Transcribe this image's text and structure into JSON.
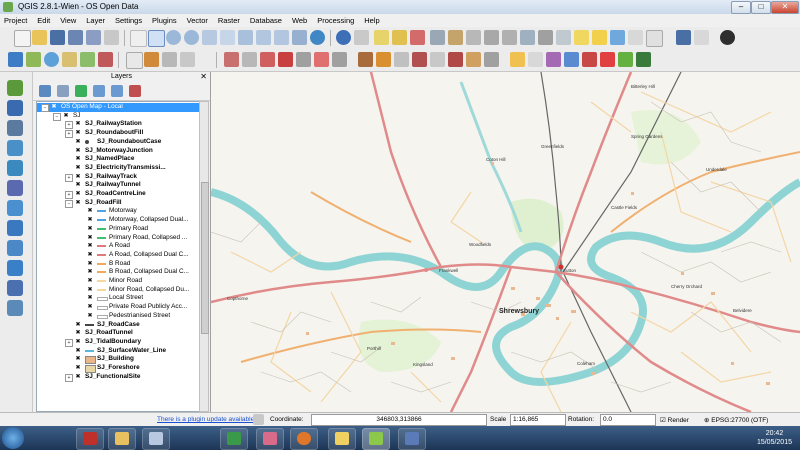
{
  "window": {
    "title": "QGIS 2.8.1-Wien - OS Open Data",
    "minimize": "–",
    "maximize": "□",
    "close": "✕"
  },
  "menu": [
    "Project",
    "Edit",
    "View",
    "Layer",
    "Settings",
    "Plugins",
    "Vector",
    "Raster",
    "Database",
    "Web",
    "Processing",
    "Help"
  ],
  "layers_panel": {
    "title": "Layers",
    "close": "✕",
    "items": [
      {
        "label": "OS Open Map - Local",
        "level": 0,
        "selected": true,
        "expander": "−"
      },
      {
        "label": "SJ",
        "level": 1,
        "expander": "−"
      },
      {
        "label": "SJ_RailwayStation",
        "level": 2,
        "expander": "+",
        "bold": true
      },
      {
        "label": "SJ_RoundaboutFill",
        "level": 2,
        "expander": "+",
        "bold": true
      },
      {
        "label": "SJ_RoundaboutCase",
        "level": 2,
        "bold": true,
        "symbol": "dot"
      },
      {
        "label": "SJ_MotorwayJunction",
        "level": 2,
        "bold": true
      },
      {
        "label": "SJ_NamedPlace",
        "level": 2,
        "bold": true
      },
      {
        "label": "SJ_ElectricityTransmissi...",
        "level": 2,
        "bold": true
      },
      {
        "label": "SJ_RailwayTrack",
        "level": 2,
        "expander": "+",
        "bold": true
      },
      {
        "label": "SJ_RailwayTunnel",
        "level": 2,
        "bold": true
      },
      {
        "label": "SJ_RoadCentreLine",
        "level": 2,
        "expander": "+",
        "bold": true
      },
      {
        "label": "SJ_RoadFill",
        "level": 2,
        "expander": "−",
        "bold": true
      },
      {
        "label": "Motorway",
        "level": 3,
        "symbol": "line",
        "color": "#4fa3e0"
      },
      {
        "label": "Motorway, Collapsed Dual...",
        "level": 3,
        "symbol": "line",
        "color": "#4fa3e0"
      },
      {
        "label": "Primary Road",
        "level": 3,
        "symbol": "line",
        "color": "#3fbf6f"
      },
      {
        "label": "Primary Road, Collapsed ...",
        "level": 3,
        "symbol": "line",
        "color": "#3fbf6f"
      },
      {
        "label": "A Road",
        "level": 3,
        "symbol": "line",
        "color": "#e07a7a"
      },
      {
        "label": "A Road, Collapsed Dual C...",
        "level": 3,
        "symbol": "line",
        "color": "#e07a7a"
      },
      {
        "label": "B Road",
        "level": 3,
        "symbol": "line",
        "color": "#f0a860"
      },
      {
        "label": "B Road, Collapsed Dual C...",
        "level": 3,
        "symbol": "line",
        "color": "#f0a860"
      },
      {
        "label": "Minor Road",
        "level": 3,
        "symbol": "line",
        "color": "#f5d7a0"
      },
      {
        "label": "Minor Road, Collapsed Du...",
        "level": 3,
        "symbol": "line",
        "color": "#f5d7a0"
      },
      {
        "label": "Local Street",
        "level": 3,
        "symbol": "line",
        "color": "#ffffff"
      },
      {
        "label": "Private Road Publicly Acc...",
        "level": 3,
        "symbol": "line",
        "color": "#ffffff"
      },
      {
        "label": "Pedestrianised Street",
        "level": 3,
        "symbol": "line",
        "color": "#ffffff"
      },
      {
        "label": "SJ_RoadCase",
        "level": 2,
        "bold": true,
        "symbol": "line",
        "color": "#444444"
      },
      {
        "label": "SJ_RoadTunnel",
        "level": 2,
        "bold": true
      },
      {
        "label": "SJ_TidalBoundary",
        "level": 2,
        "expander": "+",
        "bold": true
      },
      {
        "label": "SJ_SurfaceWater_Line",
        "level": 2,
        "bold": true,
        "symbol": "line",
        "color": "#5ab8e0"
      },
      {
        "label": "SJ_Building",
        "level": 2,
        "bold": true,
        "symbol": "fill",
        "color": "#e8b88a"
      },
      {
        "label": "SJ_Foreshore",
        "level": 2,
        "bold": true,
        "symbol": "fill",
        "color": "#e8d8a8"
      },
      {
        "label": "SJ_FunctionalSite",
        "level": 2,
        "expander": "+",
        "bold": true
      }
    ]
  },
  "map": {
    "town": "Shrewsbury",
    "places": [
      "Bitterley Hill",
      "Greenfields",
      "Coton Hill",
      "Spring Gardens",
      "Underdale",
      "Castle Fields",
      "Woodfields",
      "Frankwell",
      "Sutton",
      "Copthorne",
      "Belvidere",
      "Cherry Orchard",
      "Porthill",
      "Kingsland",
      "Coleham"
    ]
  },
  "status": {
    "plugin_link": "There is a plugin update available",
    "coordinate_label": "Coordinate:",
    "coordinate_value": "346803,313866",
    "scale_label": "Scale",
    "scale_value": "1:16,865",
    "rotation_label": "Rotation:",
    "rotation_value": "0.0",
    "render_label": "Render",
    "crs": "EPSG:27700 (OTF)"
  },
  "clock": {
    "time": "20:42",
    "date": "15/05/2015"
  }
}
